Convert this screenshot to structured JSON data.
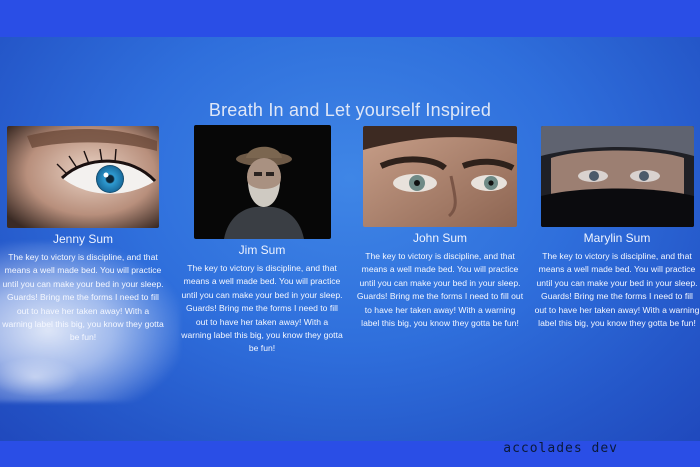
{
  "heading": "Breath In and Let yourself Inspired",
  "cards": [
    {
      "name": "Jenny Sum",
      "photo": "blue-eye-photo",
      "text": "The key to victory is discipline, and that means a well made bed. You will practice until you can make your bed in your sleep. Guards! Bring me the forms I need to fill out to have her taken away! With a warning label this big, you know they gotta be fun!"
    },
    {
      "name": "Jim Sum",
      "photo": "old-man-hat-photo",
      "text": "The key to victory is discipline, and that means a well made bed. You will practice until you can make your bed in your sleep. Guards! Bring me the forms I need to fill out to have her taken away! With a warning label this big, you know they gotta be fun!"
    },
    {
      "name": "John Sum",
      "photo": "young-man-eyes-photo",
      "text": "The key to victory is discipline, and that means a well made bed. You will practice until you can make your bed in your sleep. Guards! Bring me the forms I need to fill out to have her taken away! With a warning label this big, you know they gotta be fun!"
    },
    {
      "name": "Marylin Sum",
      "photo": "hooded-woman-photo",
      "text": "The key to victory is discipline, and that means a well made bed. You will practice until you can make your bed in your sleep. Guards! Bring me the forms I need to fill out to have her taken away! With a warning label this big, you know they gotta be fun!"
    }
  ],
  "watermark": "accolades dev",
  "colors": {
    "page_bg": "#2a4ee6",
    "sky": "#2f6fdc",
    "text": "#ffffff"
  }
}
